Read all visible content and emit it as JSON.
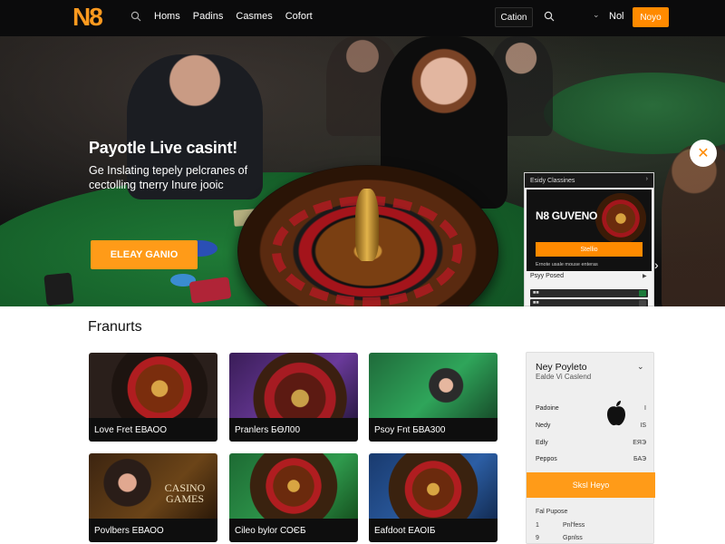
{
  "nav": {
    "logo": "N8",
    "links": [
      "Homs",
      "Padins",
      "Casmes",
      "Cofort"
    ],
    "language": "Cation",
    "user": "Nol",
    "cta": "Noyo"
  },
  "hero": {
    "headline": "Payotle Live casint!",
    "subtitle": "Ge Inslating tepely pelcranes of cectolling tnerry Inure jooic",
    "cta": "ELEAY GANIO"
  },
  "popup": {
    "header": "Esidy Classines",
    "brand": "N8 GUVENO",
    "button": "Stellio",
    "footnote": "Ernote usale mouse enteras",
    "section": "Psyy Posed"
  },
  "featured": {
    "title": "Franurts",
    "tiles": [
      {
        "caption": "Love Fret ЕВАОО"
      },
      {
        "caption": "Pranlers БӨЛ00"
      },
      {
        "caption": "Psoy Fnt БВА300"
      },
      {
        "caption": "Povlbers ЕВАОО",
        "art_text": "CASINO GAMES"
      },
      {
        "caption": "Cileo bylor СОЄБ"
      },
      {
        "caption": "Eafdoot ЕАОІБ"
      }
    ]
  },
  "side": {
    "title": "Ney Poyleto",
    "subtitle": "Ealde Vi Caslend",
    "rows": [
      {
        "label": "Padoine",
        "value": "I"
      },
      {
        "label": "Nedy",
        "value": "IS"
      },
      {
        "label": "Edly",
        "value": "EЯЭ"
      },
      {
        "label": "Peppos",
        "value": "БАЭ"
      }
    ],
    "button": "Sksl Heyo",
    "footer": [
      {
        "num": "",
        "label": "Fal Pupose"
      },
      {
        "num": "1",
        "label": "Pnl'fess"
      },
      {
        "num": "9",
        "label": "Gpnlss"
      }
    ]
  },
  "colors": {
    "accent": "#ff9b18",
    "dark": "#0b0b0c"
  }
}
